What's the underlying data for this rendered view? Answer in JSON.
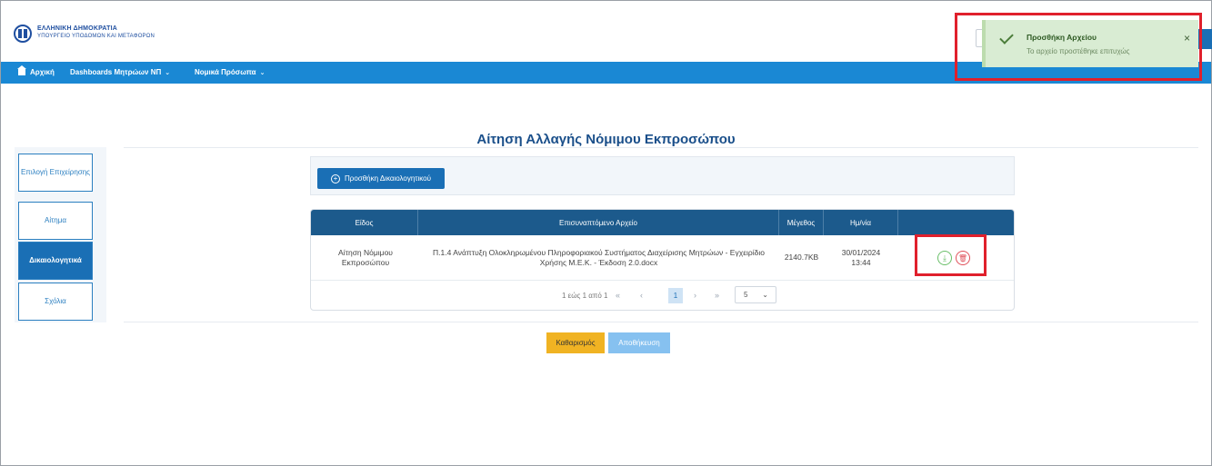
{
  "header": {
    "gov_title": "ΕΛΛΗΝΙΚΗ ΔΗΜΟΚΡΑΤΙΑ",
    "gov_subtitle": "ΥΠΟΥΡΓΕΙΟ ΥΠΟΔΟΜΩΝ ΚΑΙ ΜΕΤΑΦΟΡΩΝ",
    "logo_icon": "greek-emblem-icon"
  },
  "nav": {
    "home": "Αρχική",
    "dashboards": "Dashboards Μητρώων ΝΠ",
    "legal": "Νομικά Πρόσωπα"
  },
  "page": {
    "title": "Αίτηση Αλλαγής Νόμιμου Εκπροσώπου"
  },
  "sidebar": {
    "items": [
      {
        "label": "Επιλογή Επιχείρησης"
      },
      {
        "label": "Αίτημα"
      },
      {
        "label": "Δικαιολογητικά"
      },
      {
        "label": "Σχόλια"
      }
    ],
    "active": "Δικαιολογητικά"
  },
  "toolbar": {
    "add_label": "Προσθήκη Δικαιολογητικού"
  },
  "table": {
    "columns": [
      "Είδος",
      "Επισυναπτόμενο Αρχείο",
      "Μέγεθος",
      "Ημ/νία",
      ""
    ],
    "rows": [
      {
        "type": "Αίτηση Νόμιμου Εκπροσώπου",
        "file": "Π.1.4 Ανάπτυξη Ολοκληρωμένου Πληροφοριακού Συστήματος Διαχείρισης Μητρώων - Εγχειρίδιο Χρήσης Μ.Ε.Κ. - Έκδοση 2.0.docx",
        "size": "2140.7KB",
        "date": "30/01/2024 13:44"
      }
    ]
  },
  "pager": {
    "summary": "1 εώς 1 από 1",
    "current_page": "1",
    "page_size": "5"
  },
  "actions": {
    "clear": "Καθαρισμός",
    "save": "Αποθήκευση"
  },
  "toast": {
    "title": "Προσθήκη Αρχείου",
    "message": "Το αρχείο προστέθηκε επιτυχώς",
    "close": "×"
  },
  "colors": {
    "navbar": "#1a88d4",
    "primary": "#1a6fb5",
    "table_header": "#1c5a8c",
    "toast_bg": "#d9ecd3",
    "highlight": "#e0202c",
    "warning_button": "#f0b323"
  }
}
